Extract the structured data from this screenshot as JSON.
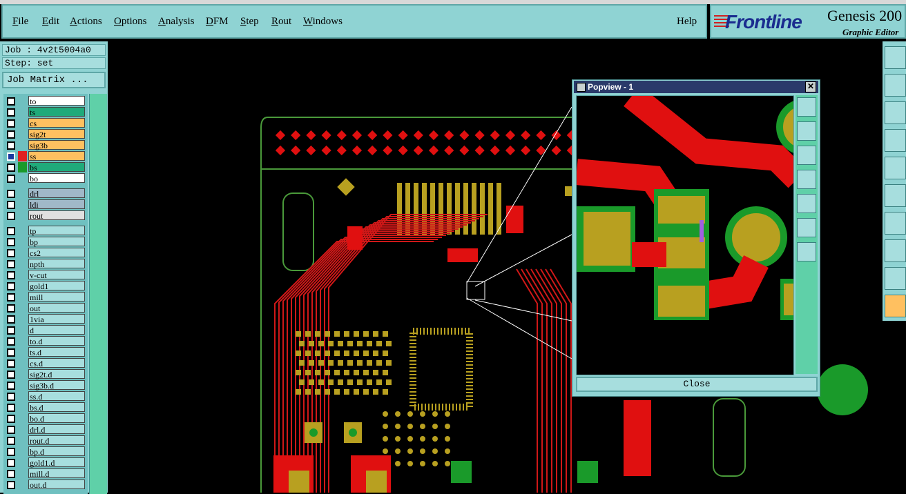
{
  "menubar": {
    "items": [
      {
        "label": "File",
        "ul": "F",
        "rest": "ile"
      },
      {
        "label": "Edit",
        "ul": "E",
        "rest": "dit"
      },
      {
        "label": "Actions",
        "ul": "A",
        "rest": "ctions"
      },
      {
        "label": "Options",
        "ul": "O",
        "rest": "ptions"
      },
      {
        "label": "Analysis",
        "ul": "A",
        "rest": "nalysis"
      },
      {
        "label": "DFM",
        "ul": "D",
        "rest": "FM"
      },
      {
        "label": "Step",
        "ul": "S",
        "rest": "tep"
      },
      {
        "label": "Rout",
        "ul": "R",
        "rest": "out"
      },
      {
        "label": "Windows",
        "ul": "W",
        "rest": "indows"
      }
    ],
    "help": "Help"
  },
  "brand": {
    "logo": "Frontline",
    "product": "Genesis 200",
    "subtitle": "Graphic Editor"
  },
  "job": {
    "job": "Job : 4v2t5004a0",
    "step": "Step: set",
    "matrix_button": "Job Matrix ..."
  },
  "layers": [
    {
      "name": "to",
      "bg": "#ffffff",
      "sw": ""
    },
    {
      "name": "ts",
      "bg": "#1faa7a",
      "sw": ""
    },
    {
      "name": "cs",
      "bg": "#ffc060",
      "sw": ""
    },
    {
      "name": "sig2t",
      "bg": "#ffc060",
      "sw": ""
    },
    {
      "name": "sig3b",
      "bg": "#ffc060",
      "sw": ""
    },
    {
      "name": "ss",
      "bg": "#ffc060",
      "sw": "#e02020",
      "sel": true
    },
    {
      "name": "bs",
      "bg": "#1faa7a",
      "sw": "#1a9a2a"
    },
    {
      "name": "bo",
      "bg": "#ffffff",
      "sw": ""
    },
    {
      "name": "drl",
      "bg": "#a0b8c8",
      "sw": ""
    },
    {
      "name": "ldi",
      "bg": "#a0b8c8",
      "sw": ""
    },
    {
      "name": "rout",
      "bg": "#e0e0e0",
      "sw": ""
    },
    {
      "name": "tp",
      "bg": "#a7dede",
      "sw": ""
    },
    {
      "name": "bp",
      "bg": "#a7dede",
      "sw": ""
    },
    {
      "name": "cs2",
      "bg": "#a7dede",
      "sw": ""
    },
    {
      "name": "npth",
      "bg": "#a7dede",
      "sw": ""
    },
    {
      "name": "v-cut",
      "bg": "#a7dede",
      "sw": ""
    },
    {
      "name": "gold1",
      "bg": "#a7dede",
      "sw": ""
    },
    {
      "name": "mill",
      "bg": "#a7dede",
      "sw": ""
    },
    {
      "name": "out",
      "bg": "#a7dede",
      "sw": ""
    },
    {
      "name": "1via",
      "bg": "#a7dede",
      "sw": ""
    },
    {
      "name": "d",
      "bg": "#a7dede",
      "sw": ""
    },
    {
      "name": "to.d",
      "bg": "#a7dede",
      "sw": ""
    },
    {
      "name": "ts.d",
      "bg": "#a7dede",
      "sw": ""
    },
    {
      "name": "cs.d",
      "bg": "#a7dede",
      "sw": ""
    },
    {
      "name": "sig2t.d",
      "bg": "#a7dede",
      "sw": ""
    },
    {
      "name": "sig3b.d",
      "bg": "#a7dede",
      "sw": ""
    },
    {
      "name": "ss.d",
      "bg": "#a7dede",
      "sw": ""
    },
    {
      "name": "bs.d",
      "bg": "#a7dede",
      "sw": ""
    },
    {
      "name": "bo.d",
      "bg": "#a7dede",
      "sw": ""
    },
    {
      "name": "drl.d",
      "bg": "#a7dede",
      "sw": ""
    },
    {
      "name": "rout.d",
      "bg": "#a7dede",
      "sw": ""
    },
    {
      "name": "bp.d",
      "bg": "#a7dede",
      "sw": ""
    },
    {
      "name": "gold1.d",
      "bg": "#a7dede",
      "sw": ""
    },
    {
      "name": "mill.d",
      "bg": "#a7dede",
      "sw": ""
    },
    {
      "name": "out.d",
      "bg": "#a7dede",
      "sw": ""
    }
  ],
  "popview": {
    "title": "Popview - 1",
    "close": "Close"
  }
}
